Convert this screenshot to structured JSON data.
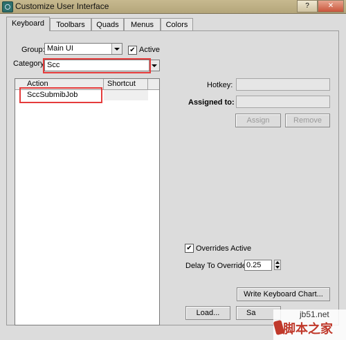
{
  "window": {
    "title": "Customize User Interface",
    "help_label": "?",
    "close_label": "✕"
  },
  "tabs": [
    {
      "label": "Keyboard",
      "active": true
    },
    {
      "label": "Toolbars",
      "active": false
    },
    {
      "label": "Quads",
      "active": false
    },
    {
      "label": "Menus",
      "active": false
    },
    {
      "label": "Colors",
      "active": false
    }
  ],
  "group": {
    "label": "Group:",
    "value": "Main UI"
  },
  "active_checkbox": {
    "label": "Active",
    "checked": true,
    "mark": "✔"
  },
  "category": {
    "label": "Category:",
    "value": "Scc"
  },
  "list": {
    "columns": [
      "Action",
      "Shortcut"
    ],
    "rows": [
      {
        "action": "SccSubmibJob",
        "shortcut": ""
      }
    ]
  },
  "hotkey": {
    "label": "Hotkey:",
    "value": ""
  },
  "assigned_to": {
    "label": "Assigned to:",
    "value": ""
  },
  "buttons": {
    "assign": "Assign",
    "remove": "Remove",
    "write_chart": "Write Keyboard Chart...",
    "load": "Load...",
    "save_partial": "Sa"
  },
  "overrides": {
    "label": "Overrides Active",
    "checked": true,
    "mark": "✔"
  },
  "delay": {
    "label": "Delay To Override:",
    "value": "0.25"
  },
  "watermark": {
    "url": "jb51.net",
    "text": "脚本之家"
  },
  "colors": {
    "highlight": "#e53b3b"
  }
}
